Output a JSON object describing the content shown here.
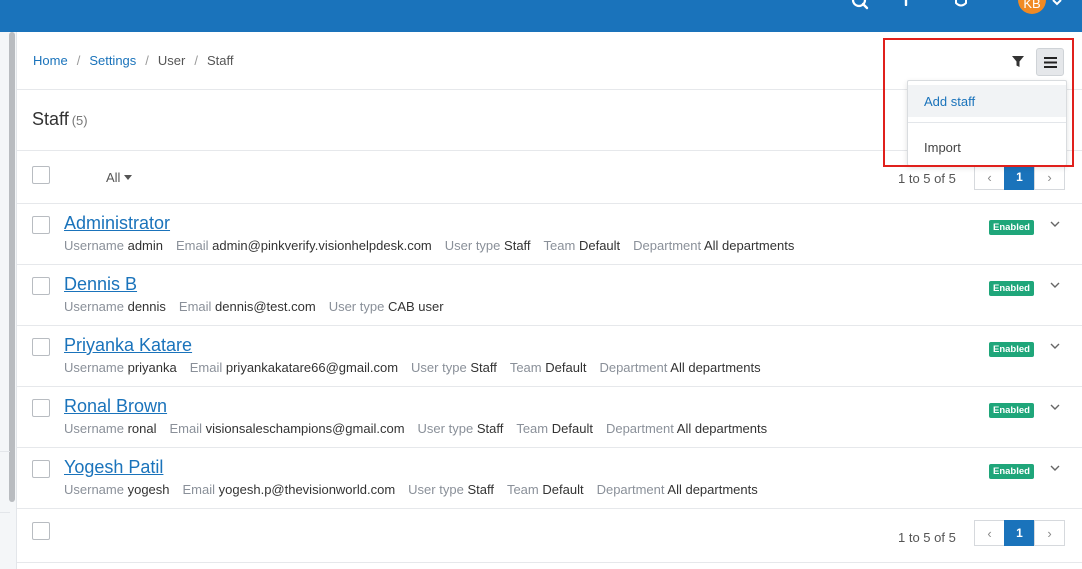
{
  "topbar": {
    "icons": [
      "search-icon",
      "plus-icon",
      "bell-icon"
    ],
    "avatar_initials": "KB",
    "brand_color": "#1a73bb"
  },
  "breadcrumb": {
    "home": "Home",
    "settings": "Settings",
    "user": "User",
    "current": "Staff",
    "separator": "/"
  },
  "toolbar": {
    "filter_icon": "filter-icon",
    "menu_icon": "hamburger-menu-icon"
  },
  "dropdown": {
    "add_staff": "Add staff",
    "import": "Import"
  },
  "page": {
    "title": "Staff",
    "count": "(5)"
  },
  "list_filter": {
    "label": "All"
  },
  "pagination": {
    "range_text": "1 to 5 of 5",
    "current_page": "1",
    "prev": "‹",
    "next": "›"
  },
  "labels": {
    "username": "Username",
    "email": "Email",
    "user_type": "User type",
    "team": "Team",
    "department": "Department"
  },
  "staff": [
    {
      "name": "Administrator",
      "username": "admin",
      "email": "admin@pinkverify.visionhelpdesk.com",
      "user_type": "Staff",
      "team": "Default",
      "department": "All departments",
      "status": "Enabled"
    },
    {
      "name": "Dennis B",
      "username": "dennis",
      "email": "dennis@test.com",
      "user_type": "CAB user",
      "team": "",
      "department": "",
      "status": "Enabled"
    },
    {
      "name": "Priyanka Katare",
      "username": "priyanka",
      "email": "priyankakatare66@gmail.com",
      "user_type": "Staff",
      "team": "Default",
      "department": "All departments",
      "status": "Enabled"
    },
    {
      "name": "Ronal Brown",
      "username": "ronal",
      "email": "visionsaleschampions@gmail.com",
      "user_type": "Staff",
      "team": "Default",
      "department": "All departments",
      "status": "Enabled"
    },
    {
      "name": "Yogesh Patil",
      "username": "yogesh",
      "email": "yogesh.p@thevisionworld.com",
      "user_type": "Staff",
      "team": "Default",
      "department": "All departments",
      "status": "Enabled"
    }
  ],
  "colors": {
    "link": "#1a73bb",
    "enabled_badge": "#1fa67a",
    "highlight_box": "#e0201c"
  }
}
